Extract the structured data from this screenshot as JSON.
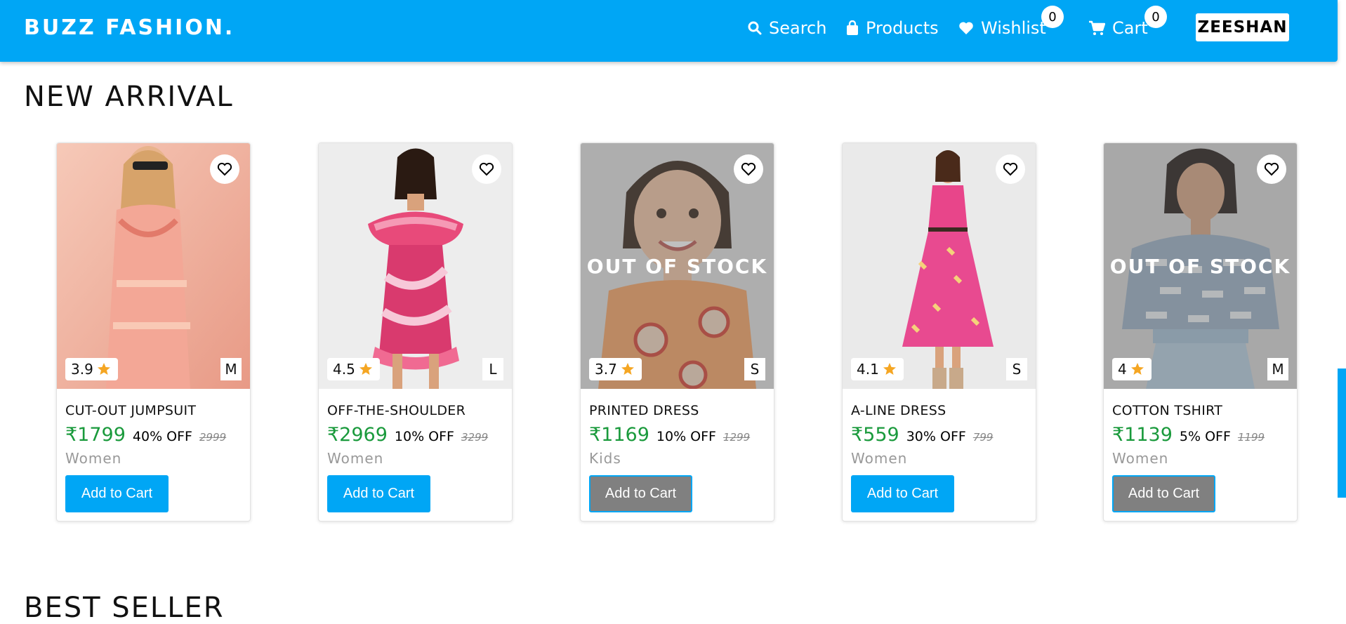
{
  "navbar": {
    "brand": "BUZZ FASHION.",
    "search_label": "Search",
    "products_label": "Products",
    "wishlist_label": "Wishlist",
    "wishlist_count": "0",
    "cart_label": "Cart",
    "cart_count": "0",
    "user_name": "ZEESHAN"
  },
  "sections": {
    "new_arrival": "NEW ARRIVAL",
    "best_seller": "BEST SELLER"
  },
  "colors": {
    "accent": "#00a6f5",
    "price_green": "#1a9a3c",
    "star": "#f5a623",
    "disabled_button": "#808080"
  },
  "products": [
    {
      "name": "CUT-OUT JUMPSUIT",
      "price": "₹1799",
      "discount": "40% OFF",
      "mrp": "2999",
      "category": "Women",
      "rating": "3.9",
      "size": "M",
      "out_of_stock": false,
      "button": "Add to Cart"
    },
    {
      "name": "OFF-THE-SHOULDER",
      "price": "₹2969",
      "discount": "10% OFF",
      "mrp": "3299",
      "category": "Women",
      "rating": "4.5",
      "size": "L",
      "out_of_stock": false,
      "button": "Add to Cart"
    },
    {
      "name": "PRINTED DRESS",
      "price": "₹1169",
      "discount": "10% OFF",
      "mrp": "1299",
      "category": "Kids",
      "rating": "3.7",
      "size": "S",
      "out_of_stock": true,
      "stock_label": "OUT OF STOCK",
      "button": "Add to Cart"
    },
    {
      "name": "A-LINE DRESS",
      "price": "₹559",
      "discount": "30% OFF",
      "mrp": "799",
      "category": "Women",
      "rating": "4.1",
      "size": "S",
      "out_of_stock": false,
      "button": "Add to Cart"
    },
    {
      "name": "COTTON TSHIRT",
      "price": "₹1139",
      "discount": "5% OFF",
      "mrp": "1199",
      "category": "Women",
      "rating": "4",
      "size": "M",
      "out_of_stock": true,
      "stock_label": "OUT OF STOCK",
      "button": "Add to Cart"
    }
  ]
}
